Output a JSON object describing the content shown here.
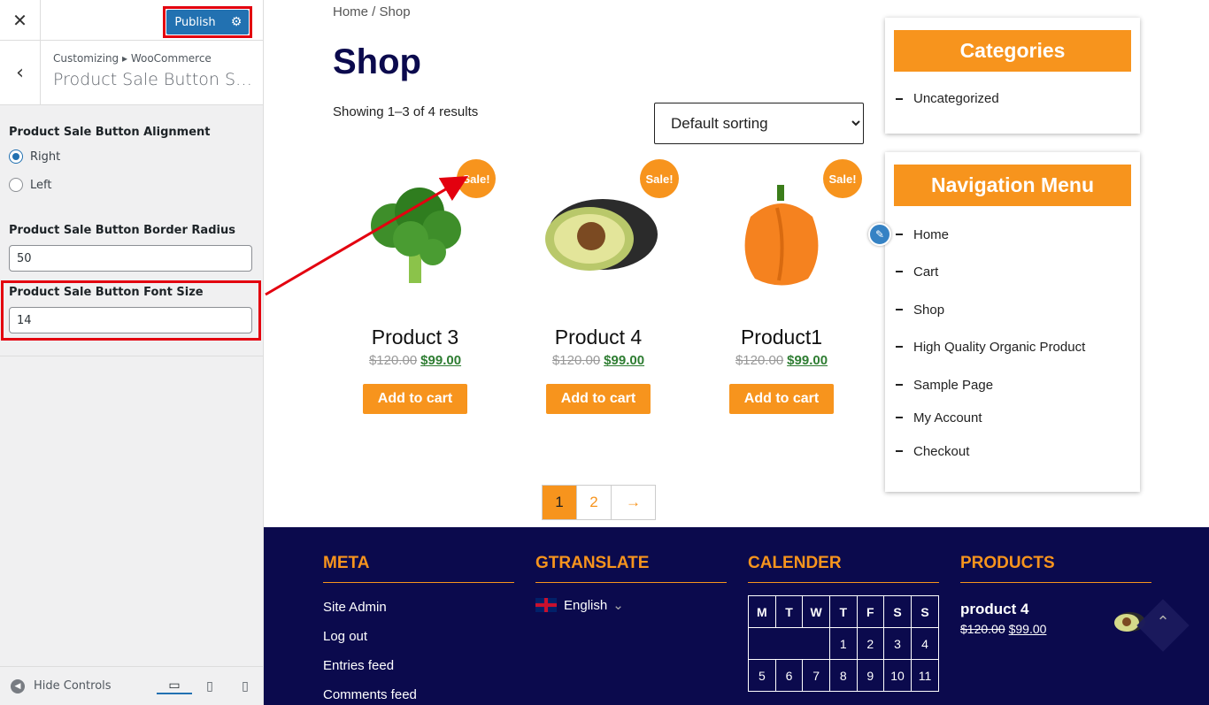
{
  "customizer": {
    "close_label": "✕",
    "publish_label": "Publish",
    "breadcrumb": "Customizing ▸ WooCommerce",
    "section_title": "Product Sale Button Set…",
    "alignment_label": "Product Sale Button Alignment",
    "alignment_options": [
      "Right",
      "Left"
    ],
    "alignment_selected": "Right",
    "radius_label": "Product Sale Button Border Radius",
    "radius_value": "50",
    "font_size_label": "Product Sale Button Font Size",
    "font_size_value": "14",
    "hide_controls": "Hide Controls"
  },
  "preview": {
    "breadcrumb": "Home / Shop",
    "title": "Shop",
    "results": "Showing 1–3 of 4 results",
    "sorting": "Default sorting",
    "sale_badge": "Sale!",
    "add_to_cart": "Add to cart",
    "products": [
      {
        "name": "Product 3",
        "old_price": "$120.00",
        "price": "$99.00",
        "image": "broccoli"
      },
      {
        "name": "Product 4",
        "old_price": "$120.00",
        "price": "$99.00",
        "image": "avocado"
      },
      {
        "name": "Product1",
        "old_price": "$120.00",
        "price": "$99.00",
        "image": "bell-pepper"
      }
    ],
    "pagination": [
      "1",
      "2",
      "→"
    ],
    "categories": {
      "title": "Categories",
      "items": [
        "Uncategorized"
      ]
    },
    "navigation": {
      "title": "Navigation Menu",
      "items": [
        "Home",
        "Cart",
        "Shop",
        "High Quality Organic Product",
        "Sample Page",
        "My Account",
        "Checkout"
      ]
    },
    "footer": {
      "meta": {
        "title": "META",
        "links": [
          "Site Admin",
          "Log out",
          "Entries feed",
          "Comments feed"
        ]
      },
      "gtranslate": {
        "title": "GTRANSLATE",
        "language": "English"
      },
      "calendar": {
        "title": "CALENDER",
        "days": [
          "M",
          "T",
          "W",
          "T",
          "F",
          "S",
          "S"
        ],
        "row1": [
          "",
          "",
          "",
          "1",
          "2",
          "3",
          "4"
        ],
        "row2": [
          "5",
          "6",
          "7",
          "8",
          "9",
          "10",
          "11"
        ]
      },
      "products": {
        "title": "PRODUCTS",
        "name": "product 4",
        "old_price": "$120.00",
        "price": "$99.00"
      }
    }
  },
  "colors": {
    "accent": "#f7941d",
    "navy": "#0b0a4d",
    "wp_blue": "#2271b1",
    "highlight": "#e3000f"
  }
}
